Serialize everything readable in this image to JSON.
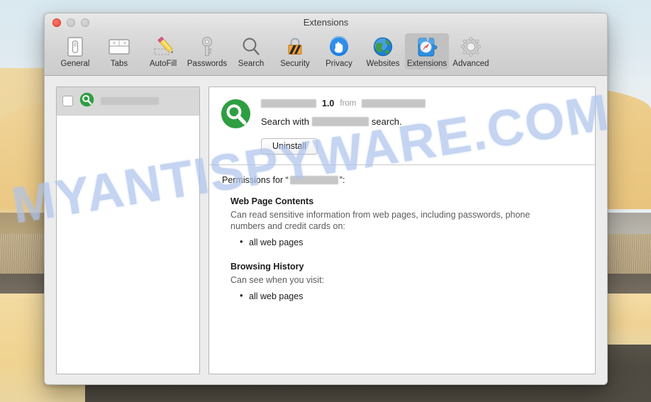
{
  "window": {
    "title": "Extensions",
    "traffic_lights": [
      "close",
      "minimize",
      "maximize"
    ]
  },
  "toolbar": {
    "items": [
      {
        "label": "General",
        "icon": "general-icon",
        "selected": false
      },
      {
        "label": "Tabs",
        "icon": "tabs-icon",
        "selected": false
      },
      {
        "label": "AutoFill",
        "icon": "autofill-icon",
        "selected": false
      },
      {
        "label": "Passwords",
        "icon": "passwords-icon",
        "selected": false
      },
      {
        "label": "Search",
        "icon": "search-icon",
        "selected": false
      },
      {
        "label": "Security",
        "icon": "security-icon",
        "selected": false
      },
      {
        "label": "Privacy",
        "icon": "privacy-icon",
        "selected": false
      },
      {
        "label": "Websites",
        "icon": "websites-icon",
        "selected": false
      },
      {
        "label": "Extensions",
        "icon": "extensions-icon",
        "selected": true
      },
      {
        "label": "Advanced",
        "icon": "advanced-icon",
        "selected": false
      }
    ]
  },
  "extension_list": {
    "rows": [
      {
        "name_redacted": true,
        "checked": false,
        "icon": "green-magnifier-icon",
        "selected": true
      }
    ]
  },
  "detail": {
    "icon": "green-magnifier-icon",
    "name_redacted": true,
    "version": "1.0",
    "from_label": "from",
    "vendor_redacted": true,
    "description_prefix": "Search with",
    "description_suffix": "search.",
    "uninstall_label": "Uninstall"
  },
  "permissions": {
    "heading_prefix": "Permissions for “",
    "heading_suffix": "”:",
    "groups": [
      {
        "title": "Web Page Contents",
        "description": "Can read sensitive information from web pages, including passwords, phone numbers and credit cards on:",
        "bullets": [
          "all web pages"
        ]
      },
      {
        "title": "Browsing History",
        "description": "Can see when you visit:",
        "bullets": [
          "all web pages"
        ]
      }
    ]
  },
  "watermark": {
    "text": "MYANTISPYWARE.COM",
    "color": "#aec4ec"
  },
  "colors": {
    "window_chrome": "#ececec",
    "toolbar_selected": "#c1c1c1",
    "extension_accent_green": "#2f9e41",
    "list_row_selected": "#d8d8d8"
  }
}
